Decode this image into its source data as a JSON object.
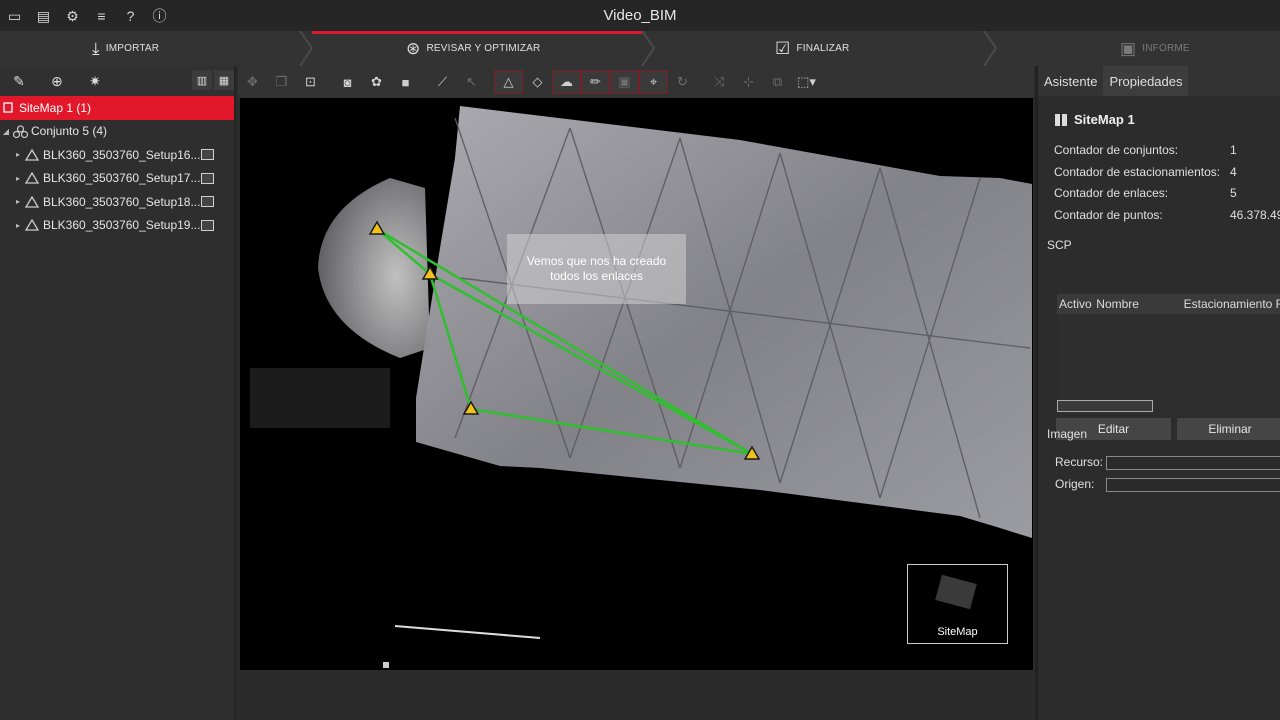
{
  "window": {
    "title": "Video_BIM"
  },
  "quick_icons": [
    "folder-icon",
    "drive-icon",
    "gear-icon",
    "database-icon",
    "help-icon",
    "info-icon"
  ],
  "workflow": {
    "steps": [
      {
        "label": "IMPORTAR",
        "icon": "import-icon",
        "state": "normal"
      },
      {
        "label": "REVISAR Y OPTIMIZAR",
        "icon": "review-icon",
        "state": "active"
      },
      {
        "label": "FINALIZAR",
        "icon": "finalize-icon",
        "state": "normal"
      },
      {
        "label": "INFORME",
        "icon": "report-icon",
        "state": "disabled"
      }
    ],
    "accent": "#d9192c"
  },
  "tree": {
    "sitemap": "SiteMap 1 (1)",
    "conjunto": "Conjunto 5 (4)",
    "setups": [
      "BLK360_3503760_Setup16...",
      "BLK360_3503760_Setup17...",
      "BLK360_3503760_Setup18...",
      "BLK360_3503760_Setup19..."
    ],
    "selected_color": "#e3172a"
  },
  "viewport": {
    "tooltip_line1": "Vemos que nos ha creado",
    "tooltip_line2": "todos los enlaces",
    "minimap_label": "SiteMap",
    "link_color": "#2fbf2f",
    "station_color": "#f2c218"
  },
  "right_panel": {
    "tabs": [
      "Asistente",
      "Propiedades"
    ],
    "sitemap_title": "SiteMap 1",
    "properties": [
      {
        "label": "Contador de conjuntos:",
        "value": "1"
      },
      {
        "label": "Contador de estacionamientos:",
        "value": "4"
      },
      {
        "label": "Contador de enlaces:",
        "value": "5"
      },
      {
        "label": "Contador de puntos:",
        "value": "46.378.49"
      }
    ],
    "scp": {
      "section": "SCP",
      "columns": [
        "Activo",
        "Nombre",
        "Estacionamiento F"
      ],
      "edit_button": "Editar",
      "delete_button": "Eliminar"
    },
    "image": {
      "section": "Imagen",
      "resource_label": "Recurso:",
      "origin_label": "Origen:"
    }
  }
}
